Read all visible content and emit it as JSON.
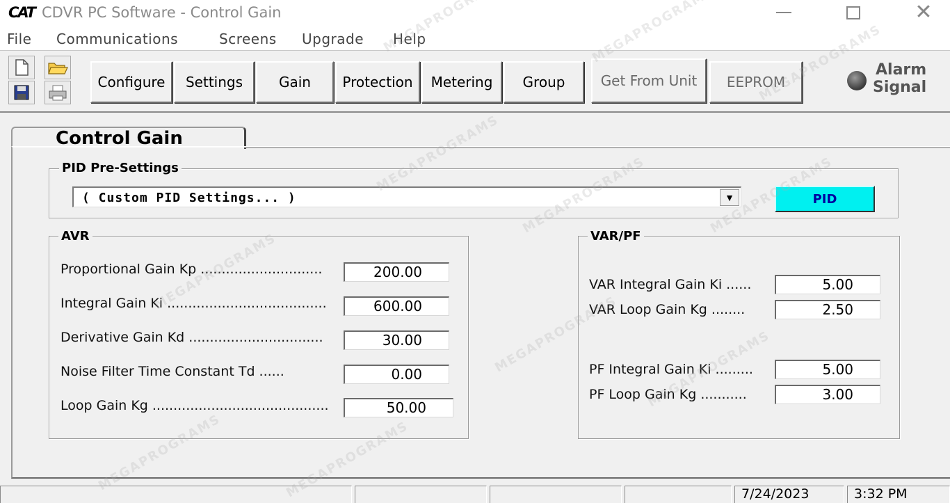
{
  "window": {
    "logo": "CAT",
    "title": "CDVR PC Software - Control Gain"
  },
  "menu": [
    "File",
    "Communications",
    "Screens",
    "Upgrade",
    "Help"
  ],
  "toolbar": {
    "icons": [
      "new-file-icon",
      "open-folder-icon",
      "save-icon",
      "print-icon"
    ],
    "buttons": [
      "Configure",
      "Settings",
      "Gain",
      "Protection",
      "Metering",
      "Group"
    ],
    "get_from_unit": "Get From Unit",
    "eeprom": "EEPROM",
    "alarm_line1": "Alarm",
    "alarm_line2": "Signal"
  },
  "tab": {
    "label": "Control Gain"
  },
  "pid_presettings": {
    "group_label": "PID Pre-Settings",
    "selected": "( Custom PID Settings... )",
    "pid_button": "PID",
    "pid_button_color": "#00f0f0"
  },
  "avr": {
    "group_label": "AVR",
    "fields": [
      {
        "label": "Proportional Gain Kp .............................",
        "value": "200.00"
      },
      {
        "label": "Integral Gain Ki ......................................",
        "value": "600.00"
      },
      {
        "label": "Derivative Gain Kd ................................",
        "value": "30.00"
      },
      {
        "label": "Noise Filter Time Constant Td ......",
        "value": "0.00"
      },
      {
        "label": "Loop Gain Kg ..........................................",
        "value": "50.00"
      }
    ]
  },
  "varpf": {
    "group_label": "VAR/PF",
    "fields": [
      {
        "label": "VAR Integral Gain Ki ......",
        "value": "5.00"
      },
      {
        "label": "VAR Loop Gain Kg ........",
        "value": "2.50"
      },
      {
        "label": "PF Integral Gain Ki .........",
        "value": "5.00"
      },
      {
        "label": "PF Loop Gain Kg ...........",
        "value": "3.00"
      }
    ]
  },
  "status": {
    "date": "7/24/2023",
    "time": "3:32 PM"
  },
  "watermark": "MEGAPROGRAMS"
}
